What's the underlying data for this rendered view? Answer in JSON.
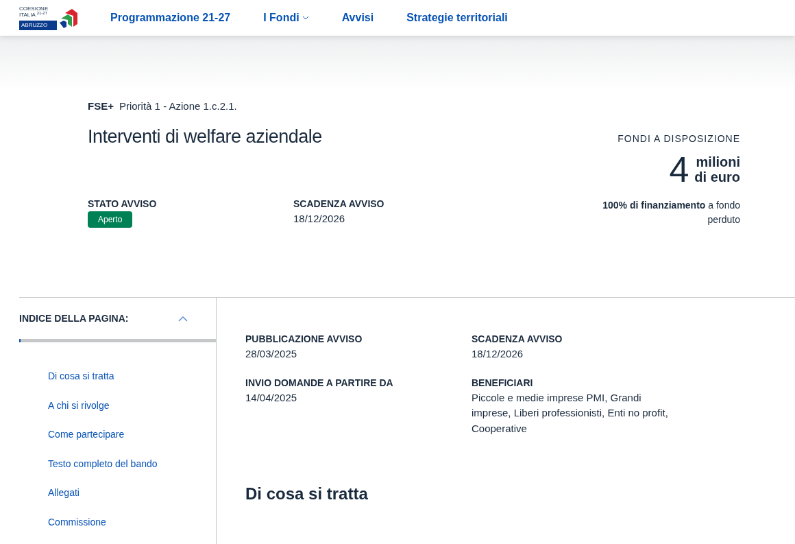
{
  "logo": {
    "line_1": "COESIONE",
    "line_2": "ITALIA",
    "years": "21-27",
    "region": "ABRUZZO"
  },
  "nav": [
    {
      "label": "Programmazione 21-27",
      "dropdown": false
    },
    {
      "label": "I Fondi",
      "dropdown": true
    },
    {
      "label": "Avvisi",
      "dropdown": false
    },
    {
      "label": "Strategie territoriali",
      "dropdown": false
    }
  ],
  "fund": "FSE+",
  "priority": "Priorità 1 - Azione 1.c.2.1.",
  "title": "Interventi di welfare aziendale",
  "status": {
    "label": "STATO AVVISO",
    "badge": "Aperto"
  },
  "deadline": {
    "label": "SCADENZA AVVISO",
    "value": "18/12/2026"
  },
  "funds": {
    "label": "FONDI A DISPOSIZIONE",
    "amount": "4",
    "unit_1": "milioni",
    "unit_2": "di euro",
    "note": "**100% di finanziamento** a fondo perduto"
  },
  "toc": {
    "title": "INDICE DELLA PAGINA:",
    "expanded": true,
    "level": 0.0,
    "items": [
      "Di cosa si tratta",
      "A chi si rivolge",
      "Come partecipare",
      "Testo completo del bando",
      "Allegati",
      "Commissione"
    ]
  },
  "details": [
    {
      "label": "PUBBLICAZIONE AVVISO",
      "value": "28/03/2025"
    },
    {
      "label": "SCADENZA AVVISO",
      "value": "18/12/2026"
    },
    {
      "label": "INVIO DOMANDE A PARTIRE DA",
      "value": "14/04/2025"
    },
    {
      "label": "BENEFICIARI",
      "value": "Piccole e medie imprese PMI, Grandi imprese, Liberi professionisti, Enti no profit, Cooperative"
    }
  ],
  "section_heading": "Di cosa si tratta"
}
